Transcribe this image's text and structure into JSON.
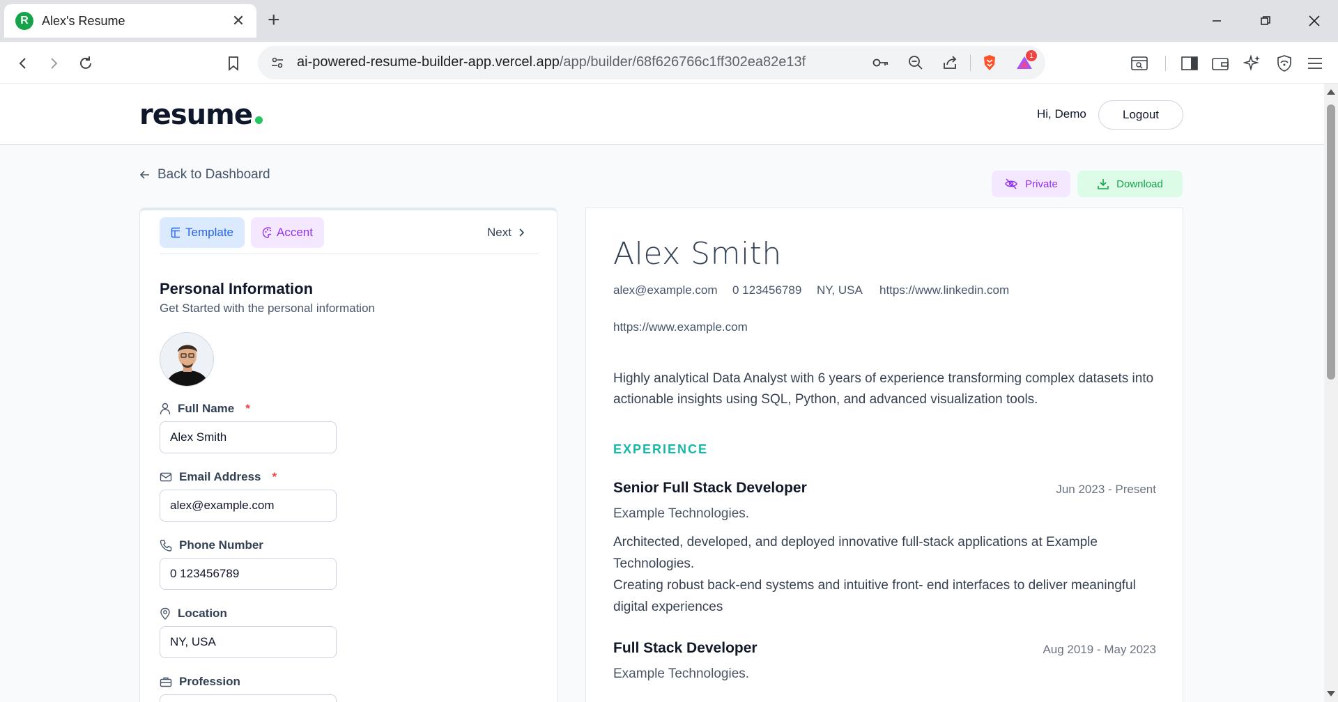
{
  "browser": {
    "tab_title": "Alex's Resume",
    "favicon_letter": "R",
    "url_host": "ai-powered-resume-builder-app.vercel.app",
    "url_path": "/app/builder/68f626766c1ff302ea82e13f",
    "extension_badge": "1"
  },
  "header": {
    "logo": "resume",
    "greeting": "Hi, Demo",
    "logout_label": "Logout"
  },
  "actions": {
    "back_label": "Back to Dashboard",
    "private_label": "Private",
    "download_label": "Download"
  },
  "editor": {
    "tabs": {
      "template": "Template",
      "accent": "Accent",
      "next": "Next"
    },
    "section_title": "Personal Information",
    "section_subtitle": "Get Started with the personal information",
    "fields": {
      "full_name": {
        "label": "Full Name",
        "required": "*",
        "value": "Alex Smith"
      },
      "email": {
        "label": "Email Address",
        "required": "*",
        "value": "alex@example.com"
      },
      "phone": {
        "label": "Phone Number",
        "value": "0 123456789"
      },
      "location": {
        "label": "Location",
        "value": "NY, USA"
      },
      "profession": {
        "label": "Profession"
      }
    }
  },
  "preview": {
    "name": "Alex Smith",
    "email": "alex@example.com",
    "phone": "0 123456789",
    "location": "NY, USA",
    "linkedin": "https://www.linkedin.com",
    "website": "https://www.example.com",
    "summary": "Highly analytical Data Analyst with 6 years of experience transforming complex datasets into actionable insights using SQL, Python, and advanced visualization tools.",
    "experience_heading": "EXPERIENCE",
    "experience": [
      {
        "role": "Senior Full Stack Developer",
        "dates": "Jun 2023 - Present",
        "company": "Example Technologies.",
        "desc1": "Architected, developed, and deployed innovative full-stack applications at Example Technologies.",
        "desc2": "Creating robust back-end systems and intuitive front- end interfaces to deliver meaningful digital experiences"
      },
      {
        "role": "Full Stack Developer",
        "dates": "Aug 2019 - May 2023",
        "company": "Example Technologies."
      }
    ]
  },
  "colors": {
    "brand_green": "#22c55e",
    "accent_teal": "#14b8a6",
    "template_blue": "#2563eb",
    "accent_purple": "#9333ea"
  }
}
